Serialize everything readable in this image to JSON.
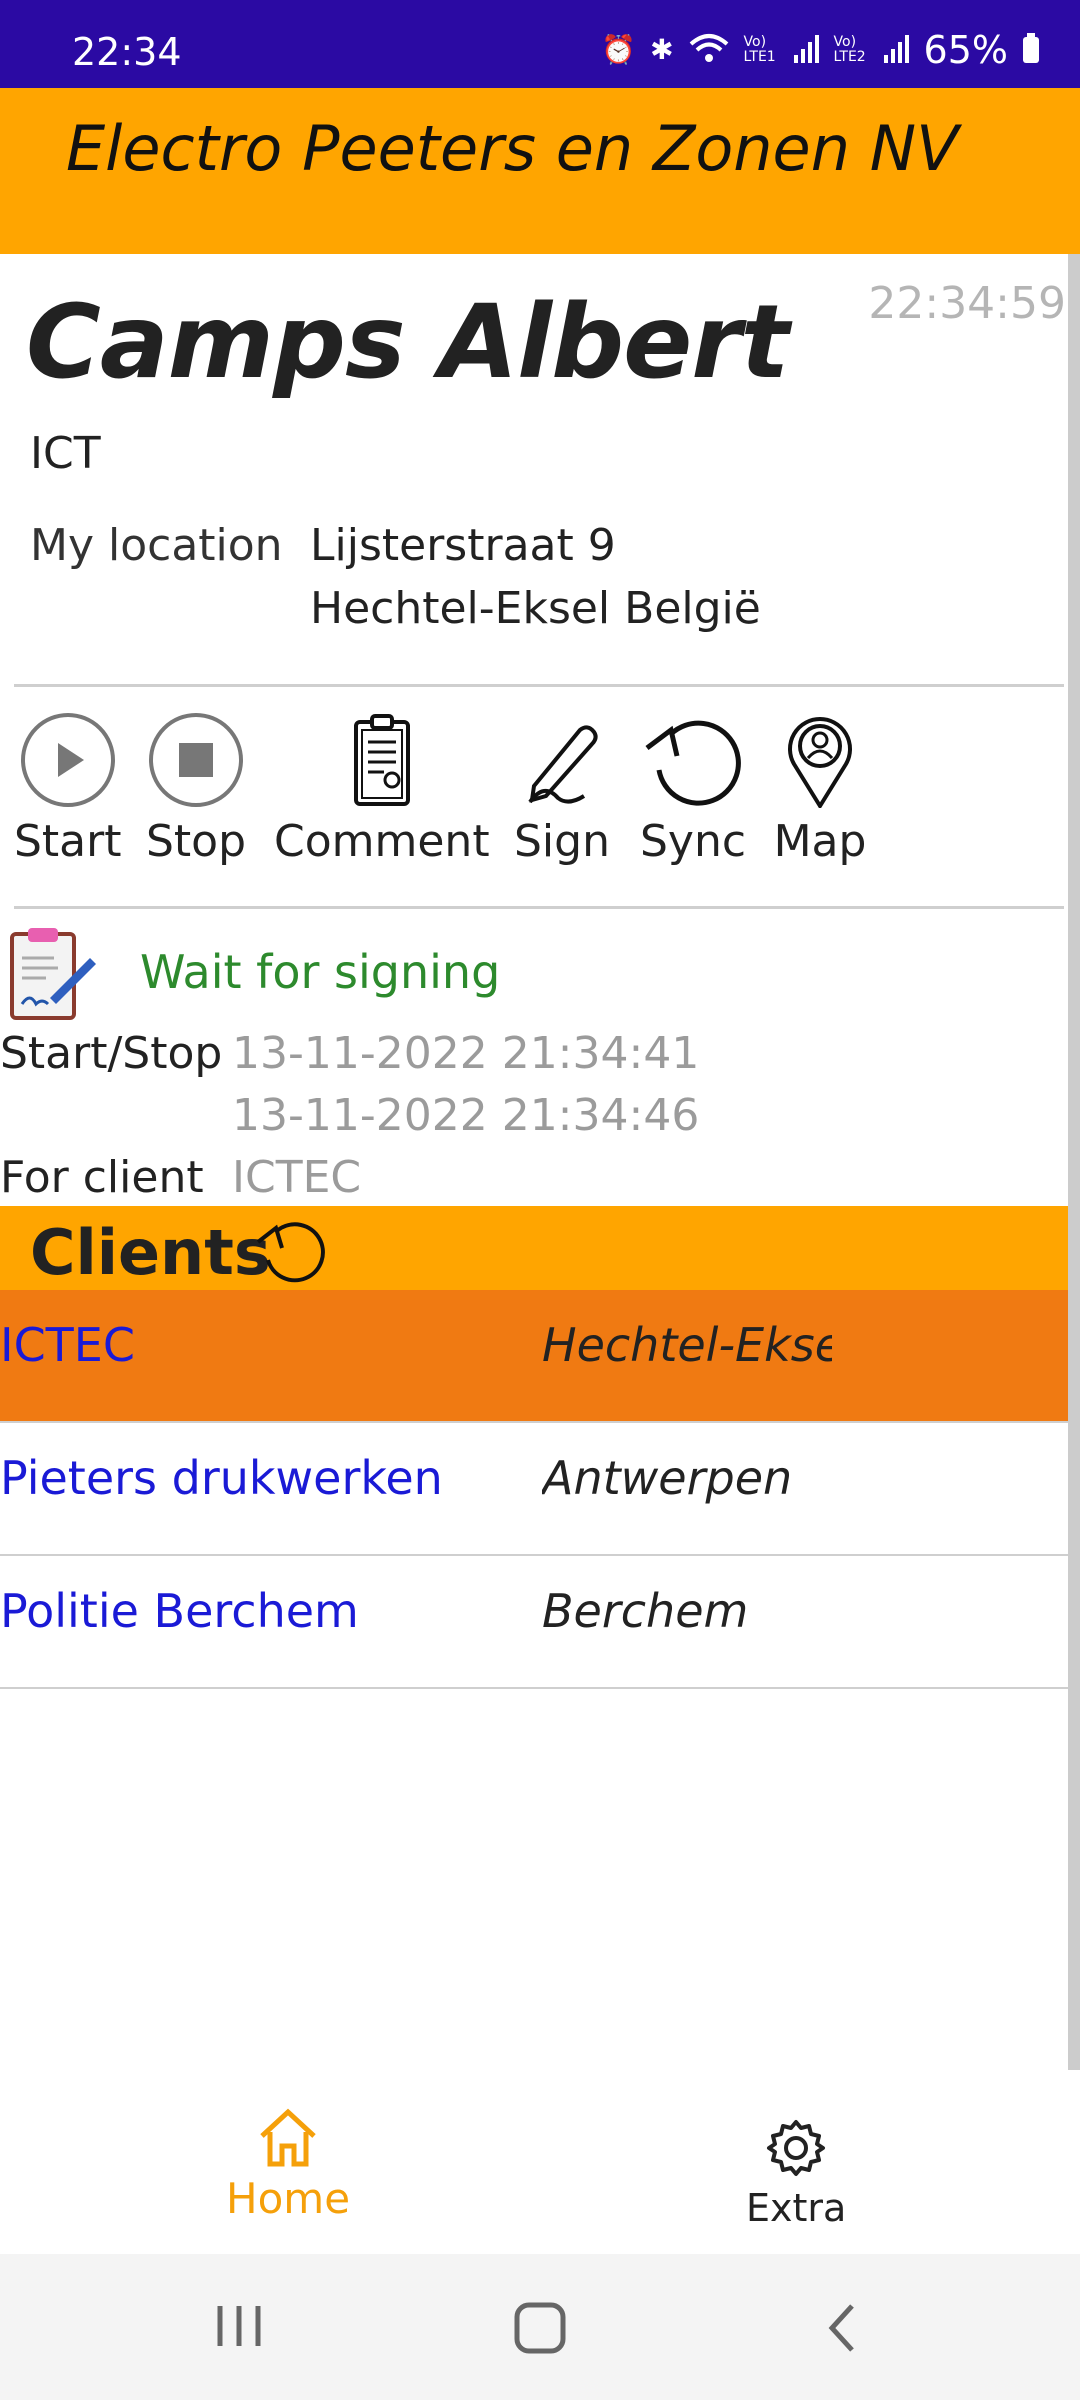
{
  "status_bar": {
    "time": "22:34",
    "battery": "65%",
    "icons": [
      "alarm-icon",
      "bluetooth-icon",
      "wifi-icon",
      "volte-lte1-icon",
      "signal-icon",
      "volte-lte2-icon",
      "signal-icon",
      "battery-icon"
    ],
    "lte1": "Vo) LTE1",
    "lte2": "Vo) LTE2"
  },
  "header": {
    "company": "Electro Peeters en Zonen NV"
  },
  "profile": {
    "clock": "22:34:59",
    "name": "Camps Albert",
    "department": "ICT",
    "location_label": "My location",
    "location_line1": "Lijsterstraat 9",
    "location_line2": "Hechtel-Eksel België"
  },
  "toolbar": {
    "start": "Start",
    "stop": "Stop",
    "comment": "Comment",
    "sign": "Sign",
    "sync": "Sync",
    "map": "Map"
  },
  "status": {
    "message": "Wait for signing",
    "start_stop_label": "Start/Stop",
    "start_time": "13-11-2022 21:34:41",
    "stop_time": "13-11-2022 21:34:46",
    "for_client_label": "For client",
    "for_client_value": "ICTEC"
  },
  "clients": {
    "title": "Clients",
    "rows": [
      {
        "name": "ICTEC",
        "city": "Hechtel-Eksel",
        "selected": true
      },
      {
        "name": "Pieters drukwerken",
        "city": "Antwerpen",
        "selected": false
      },
      {
        "name": "Politie Berchem",
        "city": "Berchem",
        "selected": false
      }
    ]
  },
  "nav": {
    "home": "Home",
    "extra": "Extra"
  },
  "colors": {
    "accent": "#ffa500",
    "selected_row": "#f07a12",
    "status_bar": "#2b0aa3",
    "link": "#1a1ad6",
    "ok_green": "#2d8a2d"
  }
}
